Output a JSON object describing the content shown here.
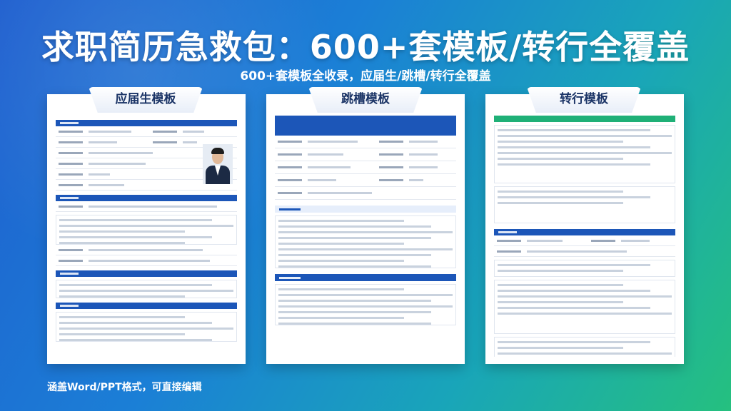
{
  "headline": "求职简历急救包：600+套模板/转行全覆盖",
  "subheadline": "600+套模板全收录，应届生/跳槽/转行全覆盖",
  "footer_note": "涵盖Word/PPT格式，可直接编辑",
  "cards": [
    {
      "label": "应届生模板"
    },
    {
      "label": "跳槽模板"
    },
    {
      "label": "转行模板"
    }
  ],
  "colors": {
    "resume_blue": "#1c56b8",
    "resume_green": "#1fb077",
    "bg_start": "#1f5fcf",
    "bg_end": "#25c07f"
  }
}
